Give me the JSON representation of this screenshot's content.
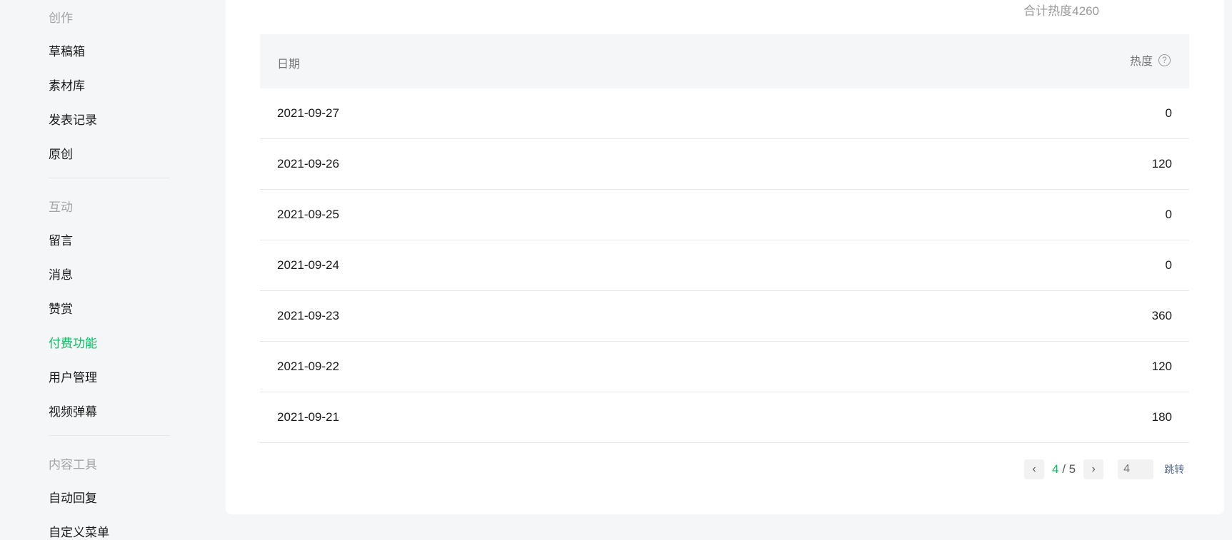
{
  "sidebar": {
    "sections": [
      {
        "label": "创作",
        "items": [
          "草稿箱",
          "素材库",
          "发表记录",
          "原创"
        ]
      },
      {
        "label": "互动",
        "items": [
          "留言",
          "消息",
          "赞赏",
          "付费功能",
          "用户管理",
          "视频弹幕"
        ]
      },
      {
        "label": "内容工具",
        "items": [
          "自动回复",
          "自定义菜单"
        ]
      }
    ],
    "active_item": "付费功能"
  },
  "summary": {
    "total_text": "合计热度4260"
  },
  "table": {
    "headers": {
      "date": "日期",
      "heat": "热度",
      "help_icon": "?"
    },
    "rows": [
      {
        "date": "2021-09-27",
        "heat": "0"
      },
      {
        "date": "2021-09-26",
        "heat": "120"
      },
      {
        "date": "2021-09-25",
        "heat": "0"
      },
      {
        "date": "2021-09-24",
        "heat": "0"
      },
      {
        "date": "2021-09-23",
        "heat": "360"
      },
      {
        "date": "2021-09-22",
        "heat": "120"
      },
      {
        "date": "2021-09-21",
        "heat": "180"
      }
    ]
  },
  "pagination": {
    "prev_icon": "‹",
    "next_icon": "›",
    "current": "4",
    "separator": " / ",
    "total": "5",
    "input_placeholder": "4",
    "jump_label": "跳转"
  },
  "colors": {
    "accent": "#07c160",
    "link": "#576b95"
  }
}
